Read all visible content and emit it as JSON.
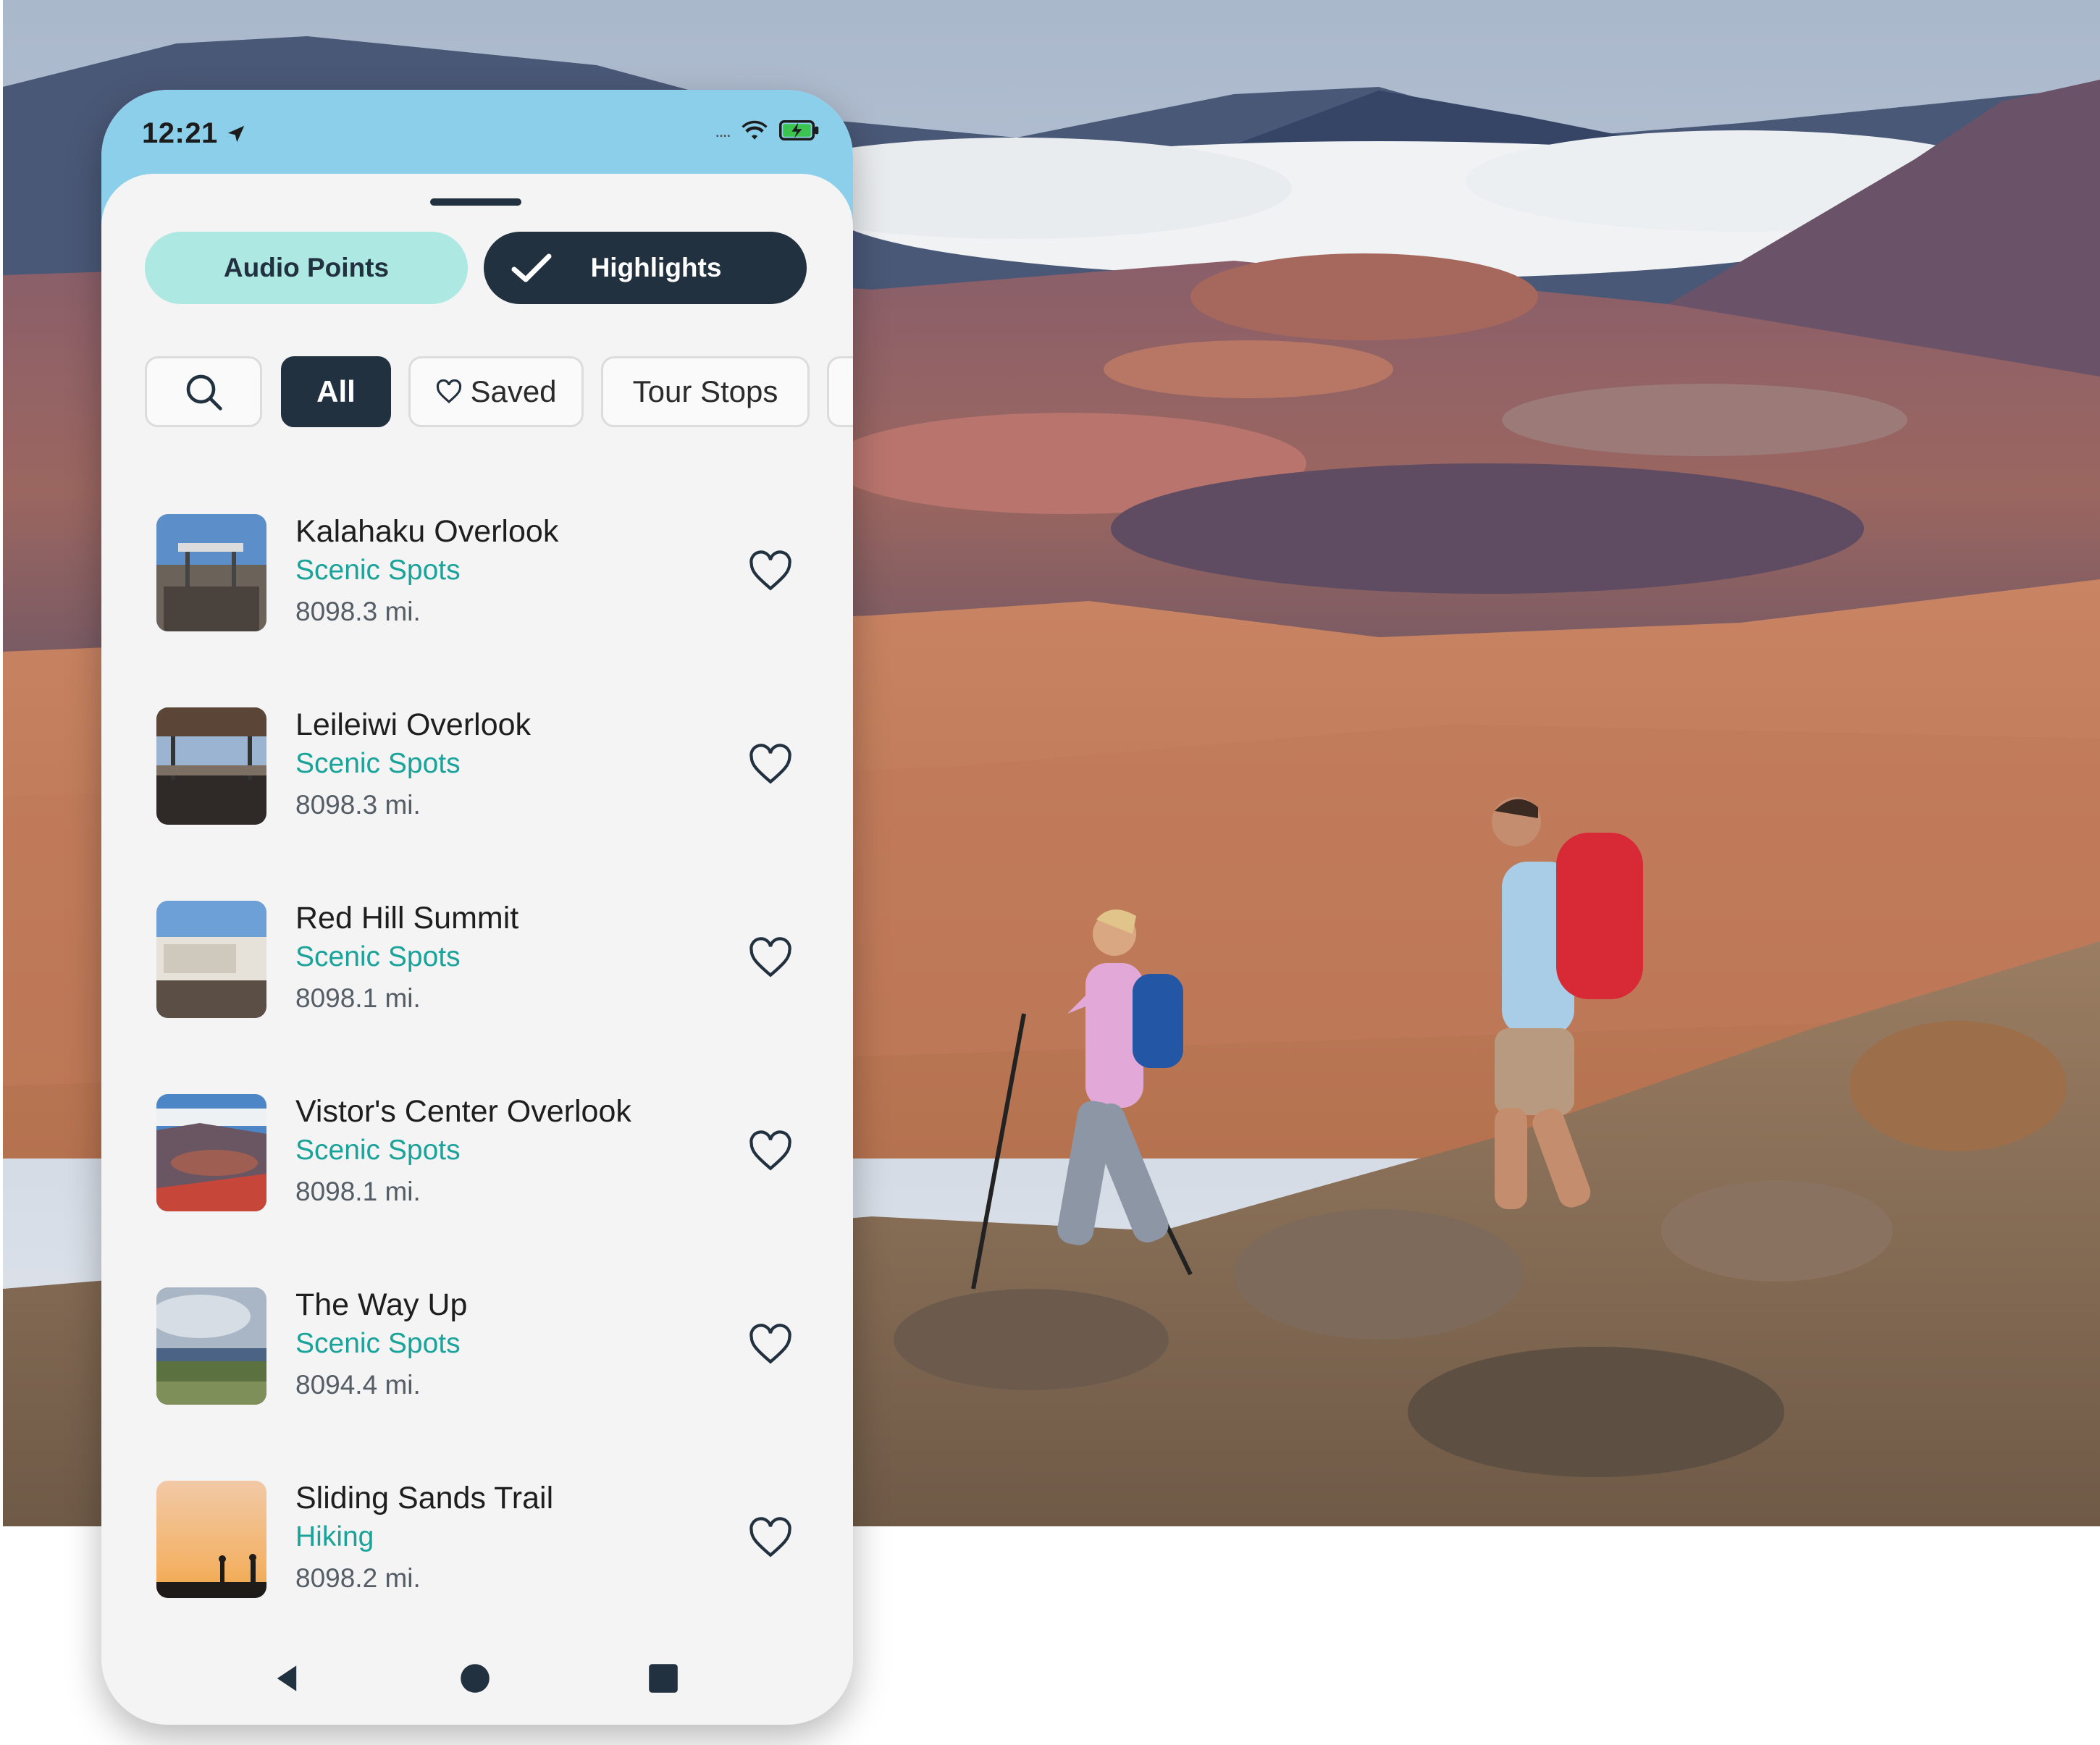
{
  "status_bar": {
    "time": "12:21"
  },
  "segments": {
    "audio_points": "Audio Points",
    "highlights": "Highlights"
  },
  "filters": {
    "all": "All",
    "saved": "Saved",
    "tour_stops": "Tour Stops"
  },
  "places": [
    {
      "title": "Kalahaku Overlook",
      "category": "Scenic Spots",
      "distance": "8098.3 mi."
    },
    {
      "title": "Leileiwi Overlook",
      "category": "Scenic Spots",
      "distance": "8098.3 mi."
    },
    {
      "title": "Red Hill Summit",
      "category": "Scenic Spots",
      "distance": "8098.1 mi."
    },
    {
      "title": "Vistor's Center Overlook",
      "category": "Scenic Spots",
      "distance": "8098.1 mi."
    },
    {
      "title": "The Way Up",
      "category": "Scenic Spots",
      "distance": "8094.4 mi."
    },
    {
      "title": "Sliding Sands Trail",
      "category": "Hiking",
      "distance": "8098.2 mi."
    }
  ],
  "icons": {
    "location_arrow": "location-arrow-icon",
    "wifi": "wifi-icon",
    "battery": "battery-charging-icon",
    "check": "check-icon",
    "search": "search-icon",
    "heart": "heart-outline-icon",
    "nav_back": "nav-back-icon",
    "nav_home": "nav-home-icon",
    "nav_recents": "nav-recents-icon"
  },
  "colors": {
    "status_bar": "#8ccfea",
    "primary_dark": "#22313f",
    "accent_mint": "#aee8e2",
    "category_teal": "#1aa39a"
  }
}
